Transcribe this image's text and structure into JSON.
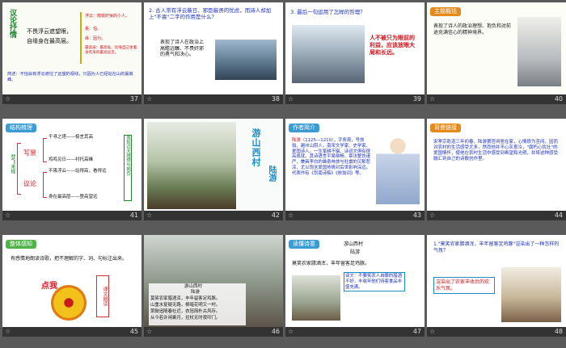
{
  "slides": [
    {
      "number": "37",
      "vertical_title": "议论抒情",
      "line1": "不畏浮云遮望眼，",
      "line2": "自缘身在最高层。",
      "notes": [
        "浮云：暗喻奸佞的小人。",
        "畏：怕。",
        "缘：因为。",
        "最高层：最高处。比喻自己坐着身有身的最高远见。"
      ],
      "bottom_note": "简述：不怕会有浮云遮住了远望的视线，只因为人已经站在山的最高峰。"
    },
    {
      "number": "38",
      "question": "2. 古人常有浮云蔽日、邪臣蔽贤的忧虑，而诗人却加上\"不畏\"二字的作用是什么？",
      "answer": "表现了诗人在政治上高瞻远瞩、不畏奸邪的勇气和决心。"
    },
    {
      "number": "39",
      "question": "3. 最后一句运用了怎样的哲理？",
      "answer": "人不被只为眼前的利益，应该放眼大局和长远。"
    },
    {
      "number": "40",
      "tag": "主题概括",
      "text": "表现了诗人的政治理想、抱负和对前途充满信心的精神境界。"
    },
    {
      "number": "41",
      "tag": "结构梳理",
      "side_label": "登飞来峰",
      "group1": "写景",
      "group2": "议论",
      "lines": [
        "千寻之塔——极言其高",
        "鸡鸣见日——衬托高峰",
        "不畏浮云——站得高，看得远",
        "身在最高层——登高望远"
      ],
      "right_label": "表现远大理想与抱负"
    },
    {
      "number": "42",
      "title": "游山西村",
      "author": "陆游"
    },
    {
      "number": "43",
      "tag": "作者简介",
      "highlight": "陆游",
      "bio": "（1125—1210），字务观，号放翁，越州山阴人，南宋文学家、史学家、爱国诗人。一生笔耕不辍，诗词文俱有很高成就。其诗语言平易晓畅、章法整饬谨严，兼具李白的雄奇奔放与杜甫的沉郁悲凉，尤以饱含爱国热情对后世影响深远。代表作有《剑南诗稿》《放翁词》等。"
    },
    {
      "number": "44",
      "tag": "背景链接",
      "text": "宋孝宗乾道三年初春，陆游罢官闲居在家，心情很为苦闷，因而对农村的生活感受尤多，然而他并不心灰意冷，\"腐朽心犹壮\"的爱国情怀，使他在农村生活中感受到希望和光明，并将这种感受融汇到自己的诗歌创作里。"
    },
    {
      "number": "45",
      "tag": "整体感知",
      "bullet": "有感情地朗读诗歌，把不理解的字、词、句标注出来。",
      "badge": "点我",
      "side_box": "课文朗读"
    },
    {
      "number": "46",
      "poem_title": "游山西村",
      "poem_author": "陆游",
      "poem_lines": [
        "莫笑农家腊酒浑，丰年留客足鸡豚。",
        "山重水复疑无路，柳暗花明又一村。",
        "箫鼓追随春社近，衣冠简朴古风存。",
        "从今若许闲乘月，拄杖无时夜叩门。"
      ]
    },
    {
      "number": "47",
      "tag": "读懂诗意",
      "title": "游山西村",
      "author": "陆游",
      "line": "莫笑农家腊酒浑，丰年留客足鸡豚。",
      "explain": "译文：不要笑农人自酿的腊酒不好，丰收年他们待客食品丰盛充满。"
    },
    {
      "number": "48",
      "question": "1.\"莫笑农家腊酒浑，丰年留客足鸡豚\"渲染出了一种怎样的气氛？",
      "answer": "渲染出了农家丰收后的欢乐气氛。"
    }
  ]
}
